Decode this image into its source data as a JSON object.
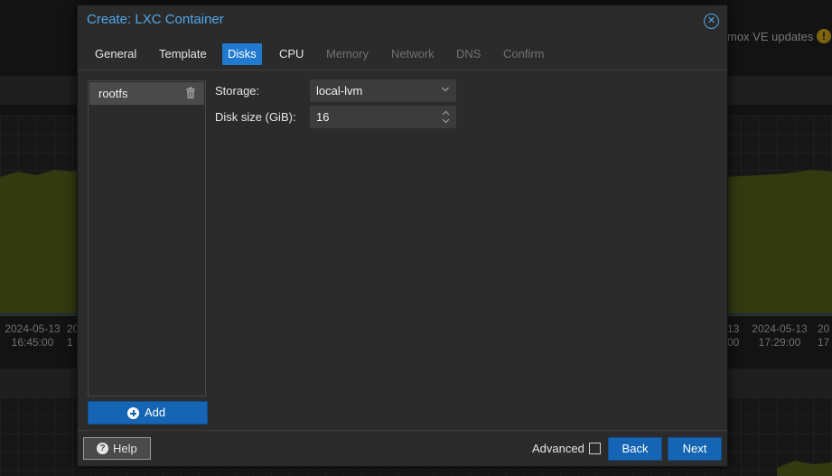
{
  "background": {
    "updates_text": "mox VE updates",
    "timestamps_left": [
      {
        "date": "2024-05-13",
        "time": "16:45:00"
      },
      {
        "date": "20",
        "time": "1"
      }
    ],
    "timestamps_right": [
      {
        "date": "13",
        "time": "00"
      },
      {
        "date": "2024-05-13",
        "time": "17:29:00"
      },
      {
        "date": "20",
        "time": "17"
      }
    ]
  },
  "dialog": {
    "title": "Create: LXC Container",
    "tabs": [
      {
        "label": "General",
        "state": "enabled"
      },
      {
        "label": "Template",
        "state": "enabled"
      },
      {
        "label": "Disks",
        "state": "active"
      },
      {
        "label": "CPU",
        "state": "enabled"
      },
      {
        "label": "Memory",
        "state": "disabled"
      },
      {
        "label": "Network",
        "state": "disabled"
      },
      {
        "label": "DNS",
        "state": "disabled"
      },
      {
        "label": "Confirm",
        "state": "disabled"
      }
    ],
    "disks": [
      {
        "label": "rootfs",
        "selected": true
      }
    ],
    "add_label": "Add",
    "storage": {
      "label": "Storage:",
      "value": "local-lvm"
    },
    "disk_size": {
      "label": "Disk size (GiB):",
      "value": "16"
    },
    "footer": {
      "help_label": "Help",
      "advanced_label": "Advanced",
      "advanced_checked": false,
      "back_label": "Back",
      "next_label": "Next"
    }
  },
  "colors": {
    "accent": "#1f7ad0",
    "title": "#51a7e8",
    "chart_fill": "#5e6a1e"
  }
}
